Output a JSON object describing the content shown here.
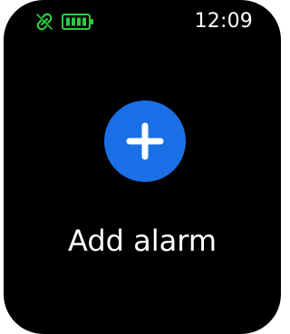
{
  "status_bar": {
    "time": "12:09",
    "connection_icon": "link-broken-icon",
    "battery_icon": "battery-icon",
    "accent_color": "#2ecc40"
  },
  "main": {
    "add_button_icon": "plus-icon",
    "add_button_color": "#1a6fe6",
    "add_label": "Add alarm"
  }
}
